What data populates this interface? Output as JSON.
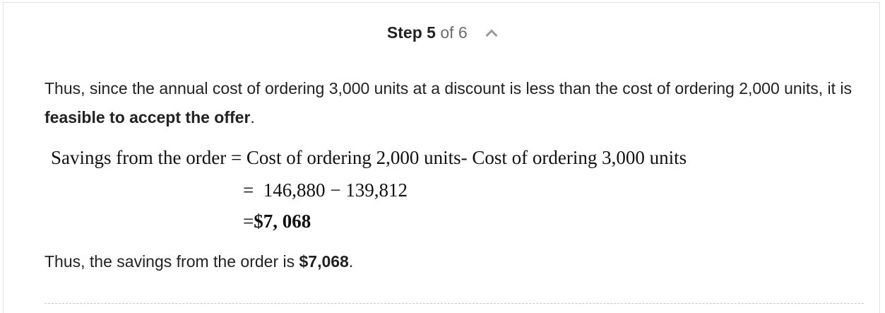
{
  "step_header": {
    "step_word": "Step",
    "step_number": "5",
    "of_word": "of",
    "total_steps": "6",
    "toggle_icon": "chevron-up-icon"
  },
  "content": {
    "paragraph1": {
      "text_before": "Thus, since the annual cost of ordering 3,000 units at a discount is less than the cost of ordering 2,000 units, it is ",
      "bold": "feasible to accept the offer",
      "text_after": "."
    },
    "equation": {
      "line1": "Savings from the order = Cost of ordering 2,000 units- Cost of ordering 3,000 units",
      "line2_eq": "=",
      "line2_expr": "146,880 − 139,812",
      "line3_eq": "=",
      "line3_value": "$7, 068"
    },
    "paragraph2": {
      "text_before": "Thus, the savings from the order is ",
      "bold": "$7,068",
      "text_after": "."
    }
  }
}
